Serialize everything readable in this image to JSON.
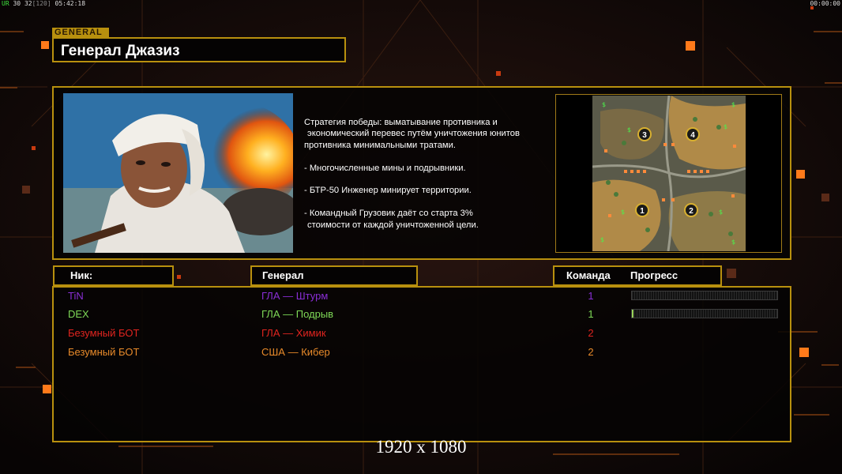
{
  "hud": {
    "left_prefix": "UR",
    "fps": "30",
    "fps2": "32",
    "fps_bracket": "[120]",
    "clock": "05:42:18",
    "right_clock": "00:00:00"
  },
  "header": {
    "tag": "GENERAL",
    "general_name": "Генерал Джазиз"
  },
  "description": {
    "strategy_lines": [
      "Стратегия победы: выматывание противника и",
      "экономический перевес путём уничтожения юнитов",
      "противника минимальными тратами."
    ],
    "bullet1": "- Многочисленные мины и подрывники.",
    "bullet2": "- БТР-50 Инженер минирует территории.",
    "bullet3_lines": [
      "- Командный Грузовик даёт со старта 3%",
      "стоимости от каждой уничтоженной цели."
    ]
  },
  "minimap": {
    "slots": [
      "1",
      "2",
      "3",
      "4"
    ]
  },
  "columns": {
    "nick": "Ник:",
    "general": "Генерал",
    "team": "Команда",
    "progress": "Прогресс"
  },
  "players": [
    {
      "nick": "TiN",
      "general": "ГЛА — Штурм",
      "team": "1",
      "color": "#8a2ed6",
      "progress": 0.0,
      "show_bar": true
    },
    {
      "nick": "DEX",
      "general": "ГЛА — Подрыв",
      "team": "1",
      "color": "#7ed957",
      "progress": 0.01,
      "show_bar": true
    },
    {
      "nick": "Безумный БОТ",
      "general": "ГЛА — Химик",
      "team": "2",
      "color": "#e0241f",
      "progress": 0,
      "show_bar": false
    },
    {
      "nick": "Безумный БОТ",
      "general": "США — Кибер",
      "team": "2",
      "color": "#e88a2a",
      "progress": 0,
      "show_bar": false
    }
  ],
  "resolution_label": "1920 x 1080",
  "colors": {
    "gold": "#b8900e",
    "accent_orange": "#f28a1a"
  }
}
